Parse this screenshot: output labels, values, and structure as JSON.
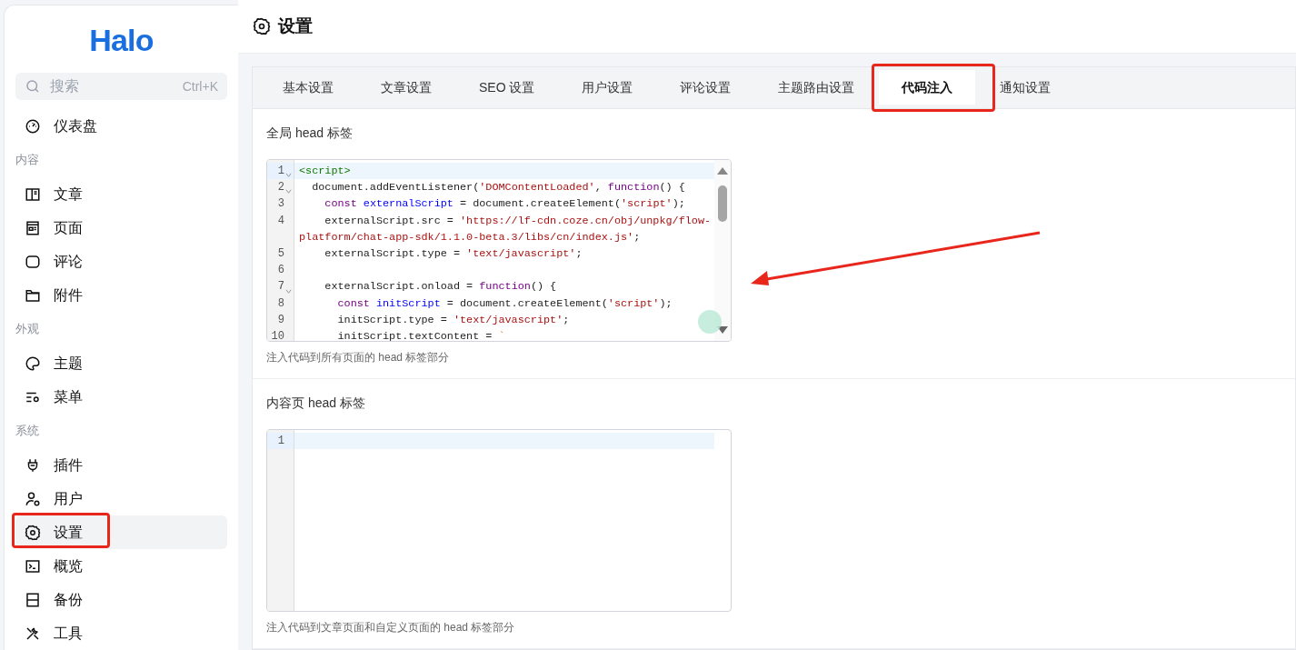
{
  "sidebar": {
    "logo": "Halo",
    "search": {
      "placeholder": "搜索",
      "shortcut": "Ctrl+K"
    },
    "items": [
      {
        "kind": "item",
        "label": "仪表盘",
        "selected": false,
        "highlighted": false
      },
      {
        "kind": "group",
        "label": "内容"
      },
      {
        "kind": "item",
        "label": "文章",
        "selected": false,
        "highlighted": false
      },
      {
        "kind": "item",
        "label": "页面",
        "selected": false,
        "highlighted": false
      },
      {
        "kind": "item",
        "label": "评论",
        "selected": false,
        "highlighted": false
      },
      {
        "kind": "item",
        "label": "附件",
        "selected": false,
        "highlighted": false
      },
      {
        "kind": "group",
        "label": "外观"
      },
      {
        "kind": "item",
        "label": "主题",
        "selected": false,
        "highlighted": false
      },
      {
        "kind": "item",
        "label": "菜单",
        "selected": false,
        "highlighted": false
      },
      {
        "kind": "group",
        "label": "系统"
      },
      {
        "kind": "item",
        "label": "插件",
        "selected": false,
        "highlighted": false
      },
      {
        "kind": "item",
        "label": "用户",
        "selected": false,
        "highlighted": false
      },
      {
        "kind": "item",
        "label": "设置",
        "selected": true,
        "highlighted": true
      },
      {
        "kind": "item",
        "label": "概览",
        "selected": false,
        "highlighted": false
      },
      {
        "kind": "item",
        "label": "备份",
        "selected": false,
        "highlighted": false
      },
      {
        "kind": "item",
        "label": "工具",
        "selected": false,
        "highlighted": false
      }
    ]
  },
  "header": {
    "title": "设置"
  },
  "tabs": [
    {
      "label": "基本设置",
      "selected": false,
      "highlighted": false
    },
    {
      "label": "文章设置",
      "selected": false,
      "highlighted": false
    },
    {
      "label": "SEO 设置",
      "selected": false,
      "highlighted": false
    },
    {
      "label": "用户设置",
      "selected": false,
      "highlighted": false
    },
    {
      "label": "评论设置",
      "selected": false,
      "highlighted": false
    },
    {
      "label": "主题路由设置",
      "selected": false,
      "highlighted": false
    },
    {
      "label": "代码注入",
      "selected": true,
      "highlighted": true
    },
    {
      "label": "通知设置",
      "selected": false,
      "highlighted": false
    }
  ],
  "fields": [
    {
      "label": "全局 head 标签",
      "pointed_at": true,
      "help": "注入代码到所有页面的 head 标签部分",
      "lines": [
        {
          "number": "1",
          "foldable": true,
          "active": true,
          "tokens": [
            {
              "kind": "tag",
              "text": "<script>"
            }
          ]
        },
        {
          "number": "2",
          "foldable": true,
          "active": false,
          "tokens": [
            {
              "kind": "plain",
              "text": "  document.addEventListener("
            },
            {
              "kind": "string",
              "text": "'DOMContentLoaded'"
            },
            {
              "kind": "plain",
              "text": ", "
            },
            {
              "kind": "keyword",
              "text": "function"
            },
            {
              "kind": "plain",
              "text": "() {"
            }
          ]
        },
        {
          "number": "3",
          "foldable": false,
          "active": false,
          "tokens": [
            {
              "kind": "keyword",
              "text": "    const"
            },
            {
              "kind": "def",
              "text": " externalScript"
            },
            {
              "kind": "plain",
              "text": " = document.createElement("
            },
            {
              "kind": "string",
              "text": "'script'"
            },
            {
              "kind": "plain",
              "text": ");"
            }
          ]
        },
        {
          "number": "4",
          "foldable": false,
          "active": false,
          "tokens": [
            {
              "kind": "plain",
              "text": "    externalScript.src = "
            },
            {
              "kind": "string",
              "text": "'https://lf-cdn.coze.cn/obj/unpkg/flow-"
            }
          ]
        },
        {
          "foldable": false,
          "active": false,
          "tokens": [
            {
              "kind": "string",
              "text": "platform/chat-app-sdk/1.1.0-beta.3/libs/cn/index.js'"
            },
            {
              "kind": "plain",
              "text": ";"
            }
          ]
        },
        {
          "number": "5",
          "foldable": false,
          "active": false,
          "tokens": [
            {
              "kind": "plain",
              "text": "    externalScript.type = "
            },
            {
              "kind": "string",
              "text": "'text/javascript'"
            },
            {
              "kind": "plain",
              "text": ";"
            }
          ]
        },
        {
          "number": "6",
          "foldable": false,
          "active": false
        },
        {
          "number": "7",
          "foldable": true,
          "active": false,
          "tokens": [
            {
              "kind": "plain",
              "text": "    externalScript.onload = "
            },
            {
              "kind": "keyword",
              "text": "function"
            },
            {
              "kind": "plain",
              "text": "() {"
            }
          ]
        },
        {
          "number": "8",
          "foldable": false,
          "active": false,
          "tokens": [
            {
              "kind": "keyword",
              "text": "      const"
            },
            {
              "kind": "def",
              "text": " initScript"
            },
            {
              "kind": "plain",
              "text": " = document.createElement("
            },
            {
              "kind": "string",
              "text": "'script'"
            },
            {
              "kind": "plain",
              "text": ");"
            }
          ]
        },
        {
          "number": "9",
          "foldable": false,
          "active": false,
          "tokens": [
            {
              "kind": "plain",
              "text": "      initScript.type = "
            },
            {
              "kind": "string",
              "text": "'text/javascript'"
            },
            {
              "kind": "plain",
              "text": ";"
            }
          ]
        },
        {
          "number": "10",
          "foldable": false,
          "active": false,
          "tokens": [
            {
              "kind": "plain",
              "text": "      initScript.textContent = "
            },
            {
              "kind": "template",
              "text": "`"
            }
          ]
        }
      ]
    },
    {
      "label": "内容页 head 标签",
      "pointed_at": false,
      "help": "注入代码到文章页面和自定义页面的 head 标签部分",
      "lines": [
        {
          "number": "1",
          "foldable": false,
          "active": true
        }
      ]
    }
  ]
}
